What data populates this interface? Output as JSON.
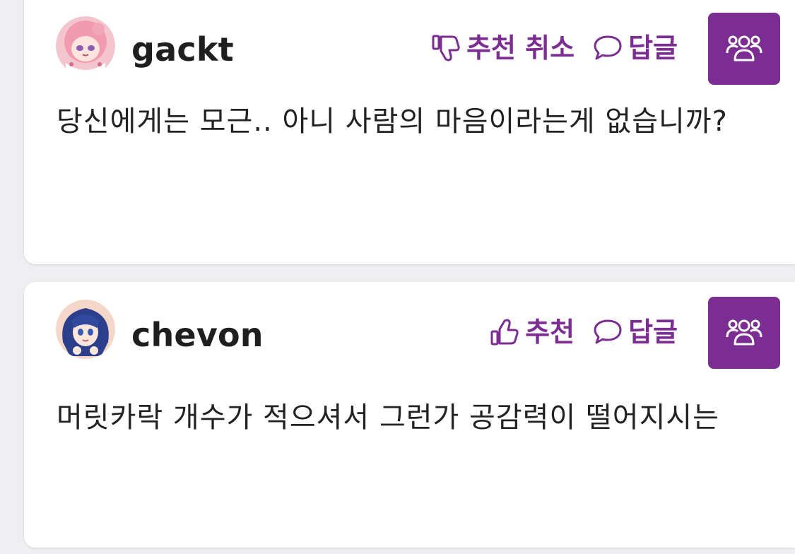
{
  "colors": {
    "accent": "#7b2d92",
    "background": "#efeff1",
    "card": "#ffffff",
    "text": "#222222"
  },
  "comments": [
    {
      "username": "gackt",
      "recommend_label": "추천 취소",
      "recommend_icon": "thumbs-down-icon",
      "reply_label": "답글",
      "reply_icon": "speech-bubble-icon",
      "group_icon": "users-icon",
      "text": "당신에게는 모근.. 아니 사람의 마음이라는게 없습니까?"
    },
    {
      "username": "chevon",
      "recommend_label": "추천",
      "recommend_icon": "thumbs-up-icon",
      "reply_label": "답글",
      "reply_icon": "speech-bubble-icon",
      "group_icon": "users-icon",
      "text": "머릿카락 개수가 적으셔서 그런가 공감력이 떨어지시는"
    }
  ]
}
